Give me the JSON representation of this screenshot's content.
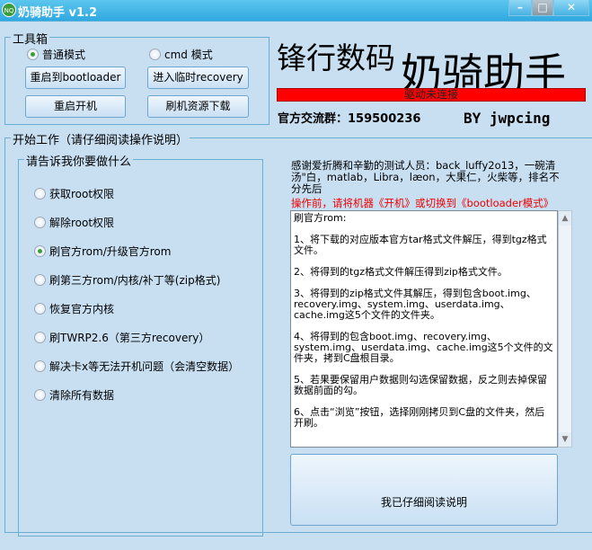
{
  "window": {
    "title": "奶骑助手 v1.2",
    "icon_text": "NQ",
    "minimize": "–",
    "maximize": "□",
    "close": "✕"
  },
  "toolbox": {
    "legend": "工具箱",
    "mode_normal": "普通模式",
    "mode_cmd": "cmd 模式",
    "selected_mode": "normal",
    "buttons": [
      "重启到bootloader",
      "进入临时recovery",
      "重启开机",
      "刷机资源下载"
    ]
  },
  "brand": {
    "company": "锋行数码",
    "app_name": "奶骑助手",
    "status": "驱动未连接",
    "status_color": "#ff0000",
    "qq_group": "官方交流群：159500236",
    "author": "BY jwpcing"
  },
  "work": {
    "legend": "开始工作（请仔细阅读操作说明）",
    "task_legend": "请告诉我你要做什么",
    "options": [
      "获取root权限",
      "解除root权限",
      "刷官方rom/升级官方rom",
      "刷第三方rom/内核/补丁等(zip格式)",
      "恢复官方内核",
      "刷TWRP2.6（第三方recovery）",
      "解决卡x等无法开机问题（会清空数据）",
      "清除所有数据"
    ],
    "selected_index": 2
  },
  "info": {
    "thanks": "感谢爱折腾和辛勤的测试人员：back_luffy2o13，一碗清汤\"白，matlab，Libra，læon，大果仁，火柴等，排名不分先后",
    "warning": "操作前，请将机器《开机》或切换到《bootloader模式》",
    "instructions": [
      "刷官方rom:",
      "1、将下载的对应版本官方tar格式文件解压，得到tgz格式文件。",
      "2、将得到的tgz格式文件解压得到zip格式文件。",
      "3、将得到的zip格式文件其解压，得到包含boot.img、recovery.img、system.img、userdata.img、cache.img这5个文件的文件夹。",
      "4、将得到的包含boot.img、recovery.img、system.img、userdata.img、cache.img这5个文件的文件夹，拷到C盘根目录。",
      "5、若果要保留用户数据则勾选保留数据，反之则去掉保留数据前面的勾。",
      "6、点击“浏览”按钮，选择刚刚拷贝到C盘的文件夹，然后开刷。"
    ],
    "confirm_button": "我已仔细阅读说明"
  }
}
